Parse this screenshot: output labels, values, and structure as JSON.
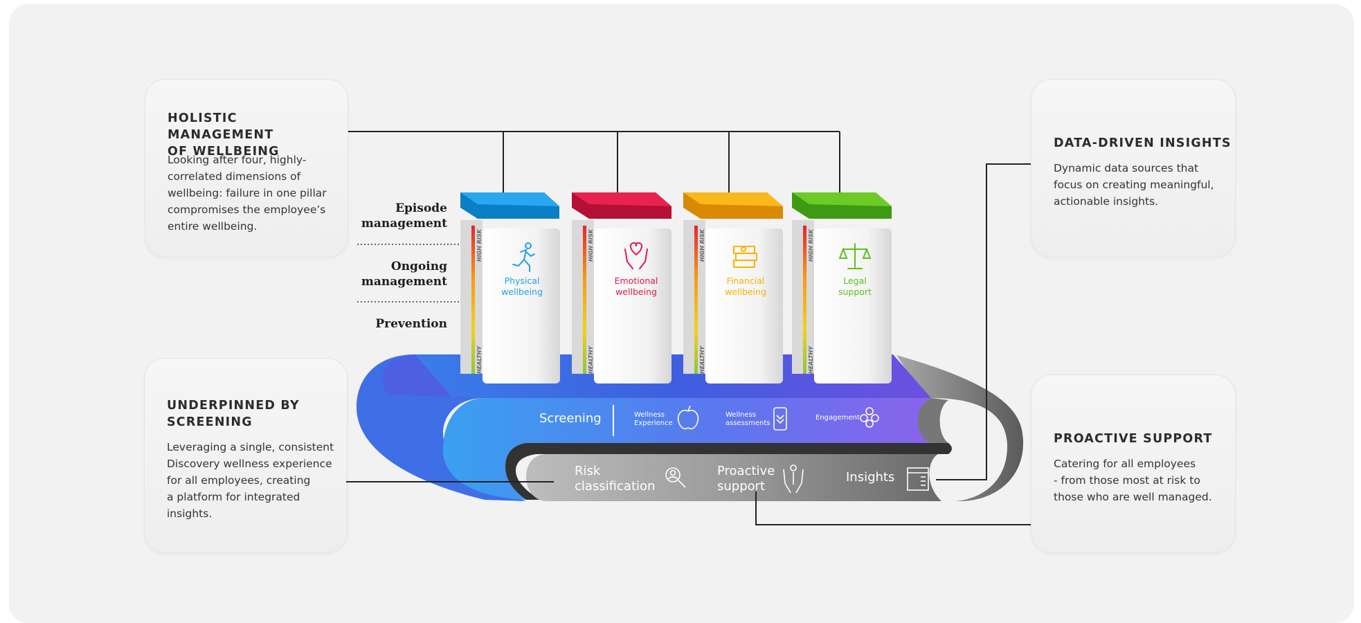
{
  "cards": {
    "holistic": {
      "title_1": "HOLISTIC MANAGEMENT",
      "title_2": "OF WELLBEING",
      "lines": [
        "Looking after four, highly-",
        "correlated dimensions of",
        "wellbeing: failure in one pillar",
        "compromises the employee’s",
        "entire wellbeing."
      ]
    },
    "screening": {
      "title_1": "UNDERPINNED BY",
      "title_2": "SCREENING",
      "lines": [
        "Leveraging a single, consistent",
        "Discovery wellness experience",
        "for all employees, creating",
        "a platform for integrated",
        "insights."
      ]
    },
    "data": {
      "title": "DATA-DRIVEN INSIGHTS",
      "lines": [
        "Dynamic data sources that",
        "focus on creating meaningful,",
        "actionable insights."
      ]
    },
    "proactive": {
      "title": "PROACTIVE SUPPORT",
      "lines": [
        "Catering for all employees",
        "- from those most at risk to",
        "those who are well managed."
      ]
    }
  },
  "levels": {
    "episode_1": "Episode",
    "episode_2": "management",
    "ongoing_1": "Ongoing",
    "ongoing_2": "management",
    "prevention": "Prevention"
  },
  "pillars": [
    {
      "line1": "Physical",
      "line2": "wellbeing",
      "color": "#1ea0e6",
      "icon": "running-person-icon",
      "side_top": "HIGH RISK",
      "side_bottom": "HEALTHY"
    },
    {
      "line1": "Emotional",
      "line2": "wellbeing",
      "color": "#e3174a",
      "icon": "heart-hands-icon",
      "side_top": "HIGH RISK",
      "side_bottom": "HEALTHY"
    },
    {
      "line1": "Financial",
      "line2": "wellbeing",
      "color": "#f7b300",
      "icon": "money-stack-icon",
      "side_top": "HIGH RISK",
      "side_bottom": "HEALTHY"
    },
    {
      "line1": "Legal",
      "line2": "support",
      "color": "#5cbf1e",
      "icon": "scales-icon",
      "side_top": "HIGH RISK",
      "side_bottom": "HEALTHY"
    }
  ],
  "belt_top": {
    "screening": "Screening",
    "wellness_exp_1": "Wellness",
    "wellness_exp_2": "Experience",
    "wellness_ass_1": "Wellness",
    "wellness_ass_2": "assessments",
    "engagement": "Engagement"
  },
  "belt_bottom": {
    "risk_1": "Risk",
    "risk_2": "classification",
    "proactive_1": "Proactive",
    "proactive_2": "support",
    "insights": "Insights"
  },
  "colors": {
    "belt_blue": "#3b6fe6",
    "belt_purple": "#7a5be6",
    "belt_grey": "#8a8a8a",
    "background": "#f2f2f2"
  }
}
